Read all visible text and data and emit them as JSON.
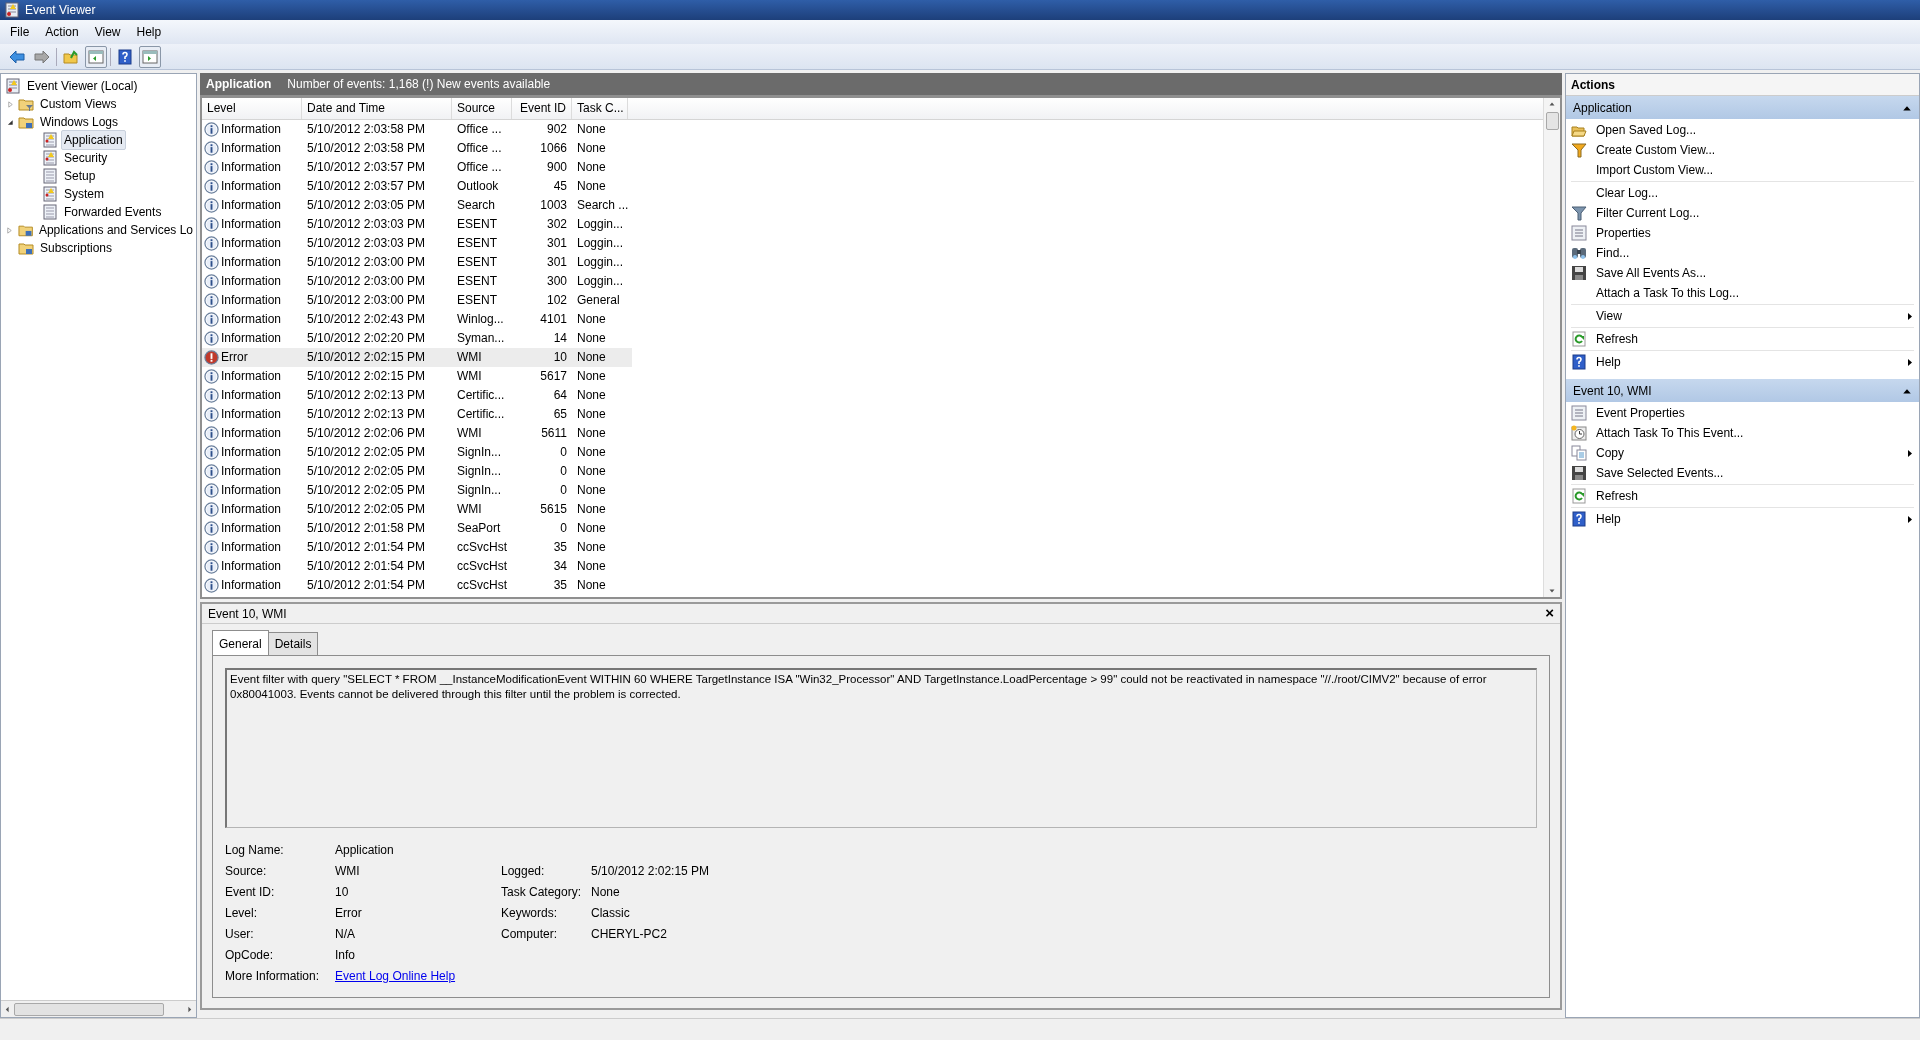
{
  "window": {
    "title": "Event Viewer"
  },
  "menu": [
    "File",
    "Action",
    "View",
    "Help"
  ],
  "tree": [
    {
      "label": "Event Viewer (Local)",
      "kind": "viewer",
      "selected": false,
      "children": [
        {
          "label": "Custom Views",
          "kind": "filterfolder",
          "selected": false,
          "expanded": false
        },
        {
          "label": "Windows Logs",
          "kind": "folder",
          "selected": false,
          "expanded": true,
          "children": [
            {
              "label": "Application",
              "kind": "log",
              "selected": true
            },
            {
              "label": "Security",
              "kind": "log",
              "selected": false
            },
            {
              "label": "Setup",
              "kind": "plainlog",
              "selected": false
            },
            {
              "label": "System",
              "kind": "log",
              "selected": false
            },
            {
              "label": "Forwarded Events",
              "kind": "plainlog",
              "selected": false
            }
          ]
        },
        {
          "label": "Applications and Services Lo",
          "kind": "folder",
          "selected": false,
          "expanded": false
        },
        {
          "label": "Subscriptions",
          "kind": "folder",
          "selected": false
        }
      ]
    }
  ],
  "header": {
    "title": "Application",
    "info": "Number of events: 1,168 (!) New events available"
  },
  "table": {
    "columns": [
      "Level",
      "Date and Time",
      "Source",
      "Event ID",
      "Task C..."
    ],
    "rows": [
      {
        "kind": "info",
        "level": "Information",
        "date": "5/10/2012 2:03:58 PM",
        "source": "Office ...",
        "event_id": "902",
        "task": "None",
        "selected": false
      },
      {
        "kind": "info",
        "level": "Information",
        "date": "5/10/2012 2:03:58 PM",
        "source": "Office ...",
        "event_id": "1066",
        "task": "None",
        "selected": false
      },
      {
        "kind": "info",
        "level": "Information",
        "date": "5/10/2012 2:03:57 PM",
        "source": "Office ...",
        "event_id": "900",
        "task": "None",
        "selected": false
      },
      {
        "kind": "info",
        "level": "Information",
        "date": "5/10/2012 2:03:57 PM",
        "source": "Outlook",
        "event_id": "45",
        "task": "None",
        "selected": false
      },
      {
        "kind": "info",
        "level": "Information",
        "date": "5/10/2012 2:03:05 PM",
        "source": "Search",
        "event_id": "1003",
        "task": "Search ...",
        "selected": false
      },
      {
        "kind": "info",
        "level": "Information",
        "date": "5/10/2012 2:03:03 PM",
        "source": "ESENT",
        "event_id": "302",
        "task": "Loggin...",
        "selected": false
      },
      {
        "kind": "info",
        "level": "Information",
        "date": "5/10/2012 2:03:03 PM",
        "source": "ESENT",
        "event_id": "301",
        "task": "Loggin...",
        "selected": false
      },
      {
        "kind": "info",
        "level": "Information",
        "date": "5/10/2012 2:03:00 PM",
        "source": "ESENT",
        "event_id": "301",
        "task": "Loggin...",
        "selected": false
      },
      {
        "kind": "info",
        "level": "Information",
        "date": "5/10/2012 2:03:00 PM",
        "source": "ESENT",
        "event_id": "300",
        "task": "Loggin...",
        "selected": false
      },
      {
        "kind": "info",
        "level": "Information",
        "date": "5/10/2012 2:03:00 PM",
        "source": "ESENT",
        "event_id": "102",
        "task": "General",
        "selected": false
      },
      {
        "kind": "info",
        "level": "Information",
        "date": "5/10/2012 2:02:43 PM",
        "source": "Winlog...",
        "event_id": "4101",
        "task": "None",
        "selected": false
      },
      {
        "kind": "info",
        "level": "Information",
        "date": "5/10/2012 2:02:20 PM",
        "source": "Syman...",
        "event_id": "14",
        "task": "None",
        "selected": false
      },
      {
        "kind": "error",
        "level": "Error",
        "date": "5/10/2012 2:02:15 PM",
        "source": "WMI",
        "event_id": "10",
        "task": "None",
        "selected": true
      },
      {
        "kind": "info",
        "level": "Information",
        "date": "5/10/2012 2:02:15 PM",
        "source": "WMI",
        "event_id": "5617",
        "task": "None",
        "selected": false
      },
      {
        "kind": "info",
        "level": "Information",
        "date": "5/10/2012 2:02:13 PM",
        "source": "Certific...",
        "event_id": "64",
        "task": "None",
        "selected": false
      },
      {
        "kind": "info",
        "level": "Information",
        "date": "5/10/2012 2:02:13 PM",
        "source": "Certific...",
        "event_id": "65",
        "task": "None",
        "selected": false
      },
      {
        "kind": "info",
        "level": "Information",
        "date": "5/10/2012 2:02:06 PM",
        "source": "WMI",
        "event_id": "5611",
        "task": "None",
        "selected": false
      },
      {
        "kind": "info",
        "level": "Information",
        "date": "5/10/2012 2:02:05 PM",
        "source": "SignIn...",
        "event_id": "0",
        "task": "None",
        "selected": false
      },
      {
        "kind": "info",
        "level": "Information",
        "date": "5/10/2012 2:02:05 PM",
        "source": "SignIn...",
        "event_id": "0",
        "task": "None",
        "selected": false
      },
      {
        "kind": "info",
        "level": "Information",
        "date": "5/10/2012 2:02:05 PM",
        "source": "SignIn...",
        "event_id": "0",
        "task": "None",
        "selected": false
      },
      {
        "kind": "info",
        "level": "Information",
        "date": "5/10/2012 2:02:05 PM",
        "source": "WMI",
        "event_id": "5615",
        "task": "None",
        "selected": false
      },
      {
        "kind": "info",
        "level": "Information",
        "date": "5/10/2012 2:01:58 PM",
        "source": "SeaPort",
        "event_id": "0",
        "task": "None",
        "selected": false
      },
      {
        "kind": "info",
        "level": "Information",
        "date": "5/10/2012 2:01:54 PM",
        "source": "ccSvcHst",
        "event_id": "35",
        "task": "None",
        "selected": false
      },
      {
        "kind": "info",
        "level": "Information",
        "date": "5/10/2012 2:01:54 PM",
        "source": "ccSvcHst",
        "event_id": "34",
        "task": "None",
        "selected": false
      },
      {
        "kind": "info",
        "level": "Information",
        "date": "5/10/2012 2:01:54 PM",
        "source": "ccSvcHst",
        "event_id": "35",
        "task": "None",
        "selected": false
      }
    ]
  },
  "detail": {
    "title": "Event 10, WMI",
    "close": "×",
    "tabs": [
      {
        "label": "General",
        "selected": true
      },
      {
        "label": "Details",
        "selected": false
      }
    ],
    "message": "Event filter with query \"SELECT * FROM __InstanceModificationEvent WITHIN 60 WHERE TargetInstance ISA \"Win32_Processor\" AND TargetInstance.LoadPercentage > 99\" could not be reactivated in namespace \"//./root/CIMV2\" because of error 0x80041003. Events cannot be delivered through this filter until the problem is corrected.",
    "fields": [
      {
        "left": {
          "label": "Log Name:",
          "value": "Application"
        }
      },
      {
        "left": {
          "label": "Source:",
          "value": "WMI"
        },
        "right": {
          "label": "Logged:",
          "value": "5/10/2012 2:02:15 PM"
        }
      },
      {
        "left": {
          "label": "Event ID:",
          "value": "10"
        },
        "right": {
          "label": "Task Category:",
          "value": "None"
        }
      },
      {
        "left": {
          "label": "Level:",
          "value": "Error"
        },
        "right": {
          "label": "Keywords:",
          "value": "Classic"
        }
      },
      {
        "left": {
          "label": "User:",
          "value": "N/A"
        },
        "right": {
          "label": "Computer:",
          "value": "CHERYL-PC2"
        }
      },
      {
        "left": {
          "label": "OpCode:",
          "value": "Info"
        }
      },
      {
        "left": {
          "label": "More Information:",
          "link": "Event Log Online Help"
        }
      }
    ]
  },
  "actions": {
    "title": "Actions",
    "sections": [
      {
        "title": "Application",
        "expanded": true,
        "groups": [
          [
            {
              "label": "Open Saved Log...",
              "kind": "openfolder",
              "submenu": false
            },
            {
              "label": "Create Custom View...",
              "kind": "filtercolor",
              "submenu": false
            },
            {
              "label": "Import Custom View...",
              "kind": "plain",
              "submenu": false
            }
          ],
          [
            {
              "label": "Clear Log...",
              "kind": "plain",
              "submenu": false
            },
            {
              "label": "Filter Current Log...",
              "kind": "filter",
              "submenu": false
            },
            {
              "label": "Properties",
              "kind": "props",
              "submenu": false
            },
            {
              "label": "Find...",
              "kind": "binoculars",
              "submenu": false
            },
            {
              "label": "Save All Events As...",
              "kind": "save",
              "submenu": false
            },
            {
              "label": "Attach a Task To this Log...",
              "kind": "plain",
              "submenu": false
            }
          ],
          [
            {
              "label": "View",
              "kind": "plain",
              "submenu": true
            }
          ],
          [
            {
              "label": "Refresh",
              "kind": "refresh",
              "submenu": false
            }
          ],
          [
            {
              "label": "Help",
              "kind": "help",
              "submenu": true
            }
          ]
        ]
      },
      {
        "title": "Event 10, WMI",
        "expanded": true,
        "groups": [
          [
            {
              "label": "Event Properties",
              "kind": "props",
              "submenu": false
            },
            {
              "label": "Attach Task To This Event...",
              "kind": "clock",
              "submenu": false
            },
            {
              "label": "Copy",
              "kind": "copy",
              "submenu": true
            },
            {
              "label": "Save Selected Events...",
              "kind": "save",
              "submenu": false
            }
          ],
          [
            {
              "label": "Refresh",
              "kind": "refresh",
              "submenu": false
            }
          ],
          [
            {
              "label": "Help",
              "kind": "help",
              "submenu": true
            }
          ]
        ]
      }
    ]
  }
}
